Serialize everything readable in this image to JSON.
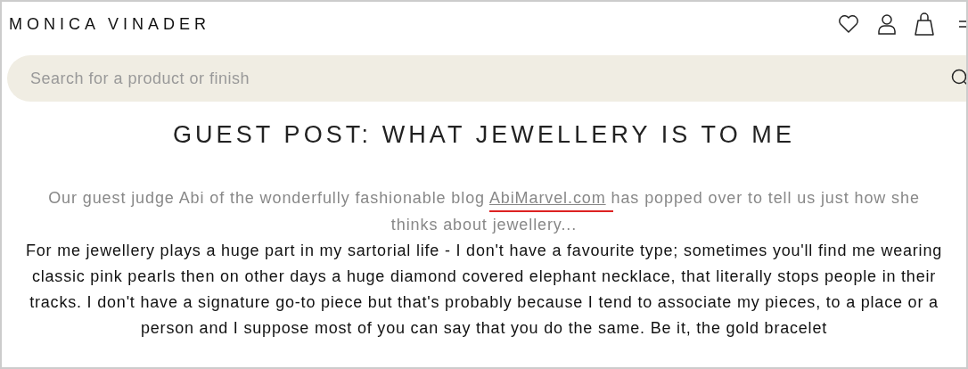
{
  "header": {
    "logo": "MONICA VINADER"
  },
  "search": {
    "placeholder": "Search for a product or finish"
  },
  "article": {
    "title": "GUEST POST: WHAT JEWELLERY IS TO ME",
    "intro": {
      "before": "Our guest judge Abi of the wonderfully fashionable blog ",
      "link": "AbiMarvel.com",
      "after": " has popped over to tell us just how she thinks about jewellery..."
    },
    "body": "For me jewellery plays a huge part in my sartorial life - I don't have a favourite type; sometimes you'll find me wearing classic pink pearls then on other days a huge diamond covered elephant necklace, that literally stops people in their tracks. I don't have a signature go-to piece but that's probably because I tend to associate my pieces, to a place or a person and I suppose most of you can say that you do the same. Be it, the gold bracelet"
  }
}
